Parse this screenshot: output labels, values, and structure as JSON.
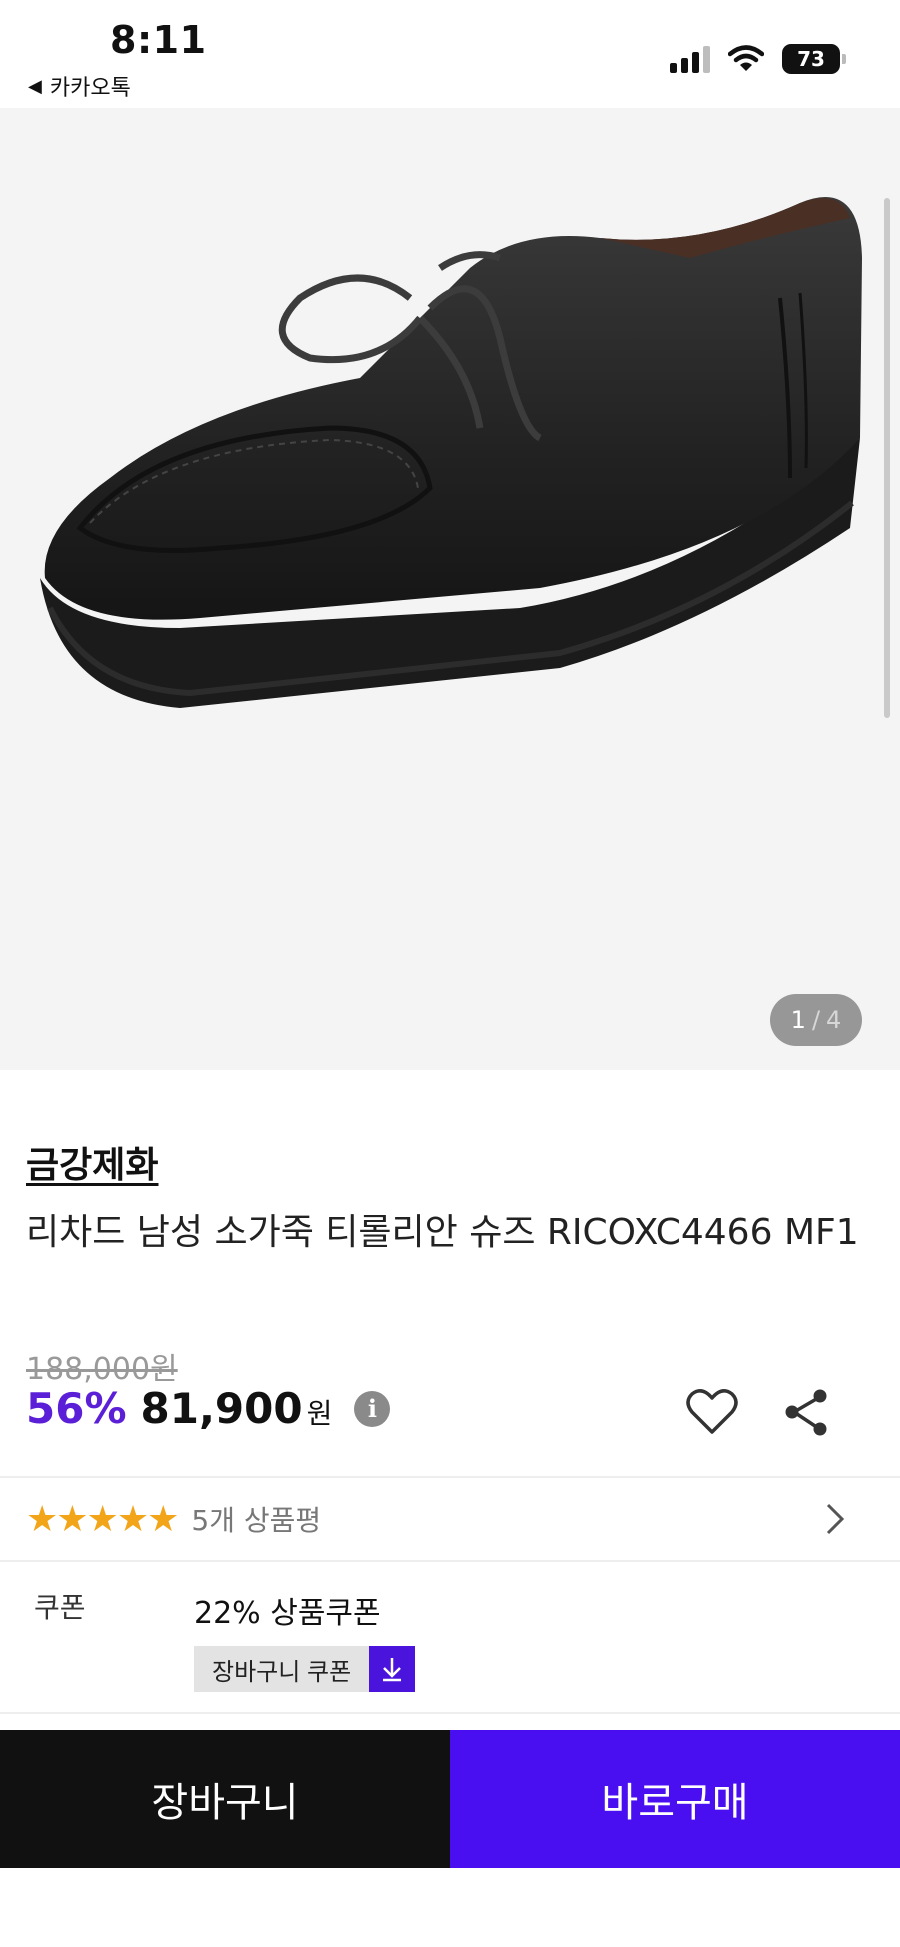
{
  "status_bar": {
    "time": "8:11",
    "back_app": "카카오톡",
    "battery": "73"
  },
  "gallery": {
    "current": "1",
    "separator": "/",
    "total": "4"
  },
  "product": {
    "brand": "금강제화",
    "title": "리차드 남성 소가죽 티롤리안 슈즈 RICOXC4466 MF1",
    "original_price": "188,000원",
    "discount": "56%",
    "price": "81,900",
    "currency": "원"
  },
  "reviews": {
    "rating": 5,
    "stars": "★★★★★",
    "count_label": "5개 상품평"
  },
  "coupon": {
    "label": "쿠폰",
    "description": "22% 상품쿠폰",
    "button_label": "장바구니 쿠폰"
  },
  "actions": {
    "cart": "장바구니",
    "buy": "바로구매"
  },
  "colors": {
    "accent": "#4a0ff0",
    "discount": "#5a1fd6",
    "star": "#f3a51a"
  }
}
